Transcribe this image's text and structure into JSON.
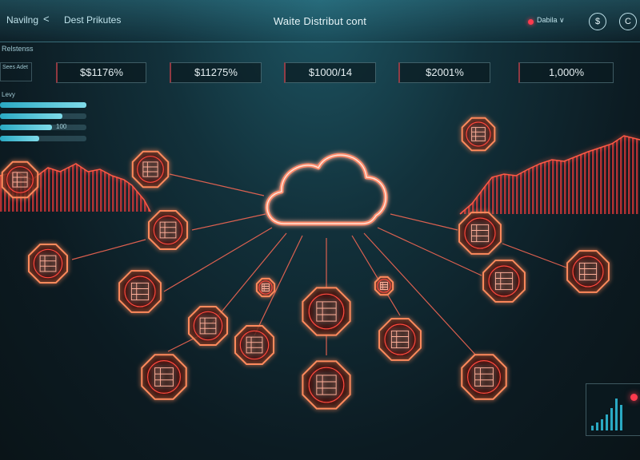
{
  "header": {
    "nav_label": "Navilng",
    "back_glyph": "<",
    "breadcrumb": "Dest Prikutes",
    "title": "Waite Distribut cont",
    "status_label": "Dabila ∨",
    "icon_dollar": "$",
    "icon_c": "C"
  },
  "section_label": "Relstenss",
  "mini_value": "Sees Adet",
  "metrics": [
    "$$1176%",
    "$11275%",
    "$1000/14",
    "$2001%",
    "1,000%"
  ],
  "side_panel": {
    "label": "Levy",
    "bars": [
      {
        "fill": 1.0,
        "text": ""
      },
      {
        "fill": 0.72,
        "text": ""
      },
      {
        "fill": 0.6,
        "text": "100"
      },
      {
        "fill": 0.45,
        "text": ""
      }
    ]
  },
  "nodes": [
    {
      "id": "n1"
    },
    {
      "id": "n2"
    },
    {
      "id": "n3"
    },
    {
      "id": "n4"
    },
    {
      "id": "n5"
    },
    {
      "id": "n6"
    },
    {
      "id": "n7"
    },
    {
      "id": "n8"
    },
    {
      "id": "n9"
    },
    {
      "id": "n10"
    },
    {
      "id": "n11"
    },
    {
      "id": "n12"
    },
    {
      "id": "n13"
    },
    {
      "id": "n14"
    },
    {
      "id": "n15"
    },
    {
      "id": "n16"
    },
    {
      "id": "n17"
    },
    {
      "id": "n18"
    },
    {
      "id": "n19"
    }
  ],
  "colors": {
    "accent": "#ff4a3d",
    "glow": "#ff8a5c",
    "teal": "#2aa9c3"
  }
}
